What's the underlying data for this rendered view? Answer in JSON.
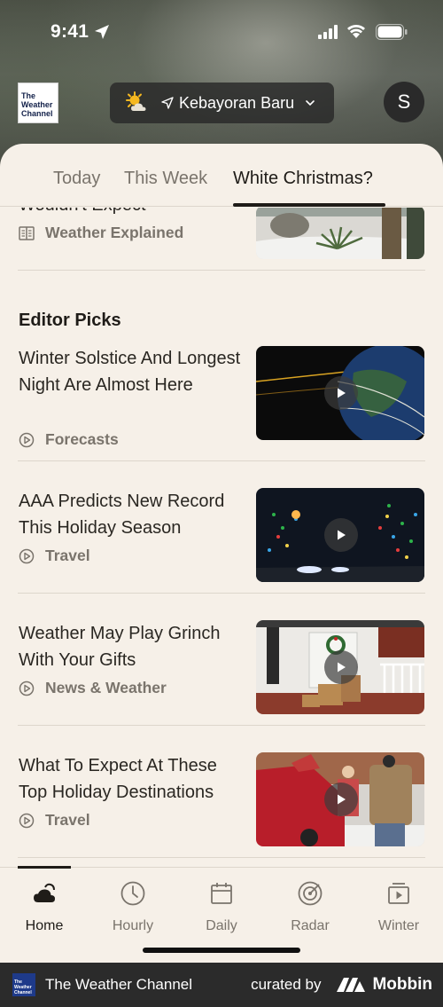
{
  "status": {
    "time": "9:41"
  },
  "header": {
    "logo_lines": [
      "The",
      "Weather",
      "Channel"
    ],
    "location": "Kebayoran Baru",
    "avatar_initial": "S"
  },
  "tabs": [
    {
      "label": "Today",
      "active": false
    },
    {
      "label": "This Week",
      "active": false
    },
    {
      "label": "White Christmas?",
      "active": true
    }
  ],
  "partial_article": {
    "title": "Wouldn't Expect",
    "category": "Weather Explained"
  },
  "editor_picks": {
    "heading": "Editor Picks",
    "articles": [
      {
        "title": "Winter Solstice And Longest Night Are Almost Here",
        "category": "Forecasts"
      },
      {
        "title": "AAA Predicts New Record This Holiday Season",
        "category": "Travel"
      },
      {
        "title": "Weather May Play Grinch With Your Gifts",
        "category": "News & Weather"
      },
      {
        "title": "What To Expect At These Top Holiday Destinations",
        "category": "Travel"
      }
    ]
  },
  "bottom_nav": [
    {
      "label": "Home",
      "icon": "cloud-icon",
      "active": true
    },
    {
      "label": "Hourly",
      "icon": "clock-icon",
      "active": false
    },
    {
      "label": "Daily",
      "icon": "calendar-icon",
      "active": false
    },
    {
      "label": "Radar",
      "icon": "radar-icon",
      "active": false
    },
    {
      "label": "Winter",
      "icon": "video-icon",
      "active": false
    }
  ],
  "footer": {
    "brand": "The Weather Channel",
    "curated": "curated by",
    "mobbin": "Mobbin"
  },
  "colors": {
    "sheet_bg": "#f6f0e8",
    "text_primary": "#1f1c18",
    "text_secondary": "#7a746c",
    "pill_bg": "#282828"
  }
}
